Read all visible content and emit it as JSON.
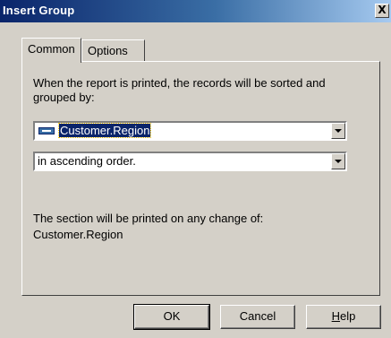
{
  "window": {
    "title": "Insert Group",
    "close_label": "X"
  },
  "tabs": [
    {
      "label": "Common",
      "active": true
    },
    {
      "label": "Options",
      "active": false
    }
  ],
  "common": {
    "prompt": "When the report is printed, the records will be sorted and grouped by:",
    "group_field": {
      "value": "Customer.Region",
      "icon": "database-field-icon"
    },
    "sort_order": {
      "value": "in ascending order."
    },
    "info_line_1": "The section will be printed on any change of:",
    "info_line_2": "Customer.Region"
  },
  "buttons": {
    "ok": "OK",
    "cancel": "Cancel",
    "help_mnemonic": "H",
    "help_rest": "elp"
  },
  "colors": {
    "title_active": "#0a246a",
    "face": "#d4d0c8",
    "selection": "#0a246a"
  }
}
